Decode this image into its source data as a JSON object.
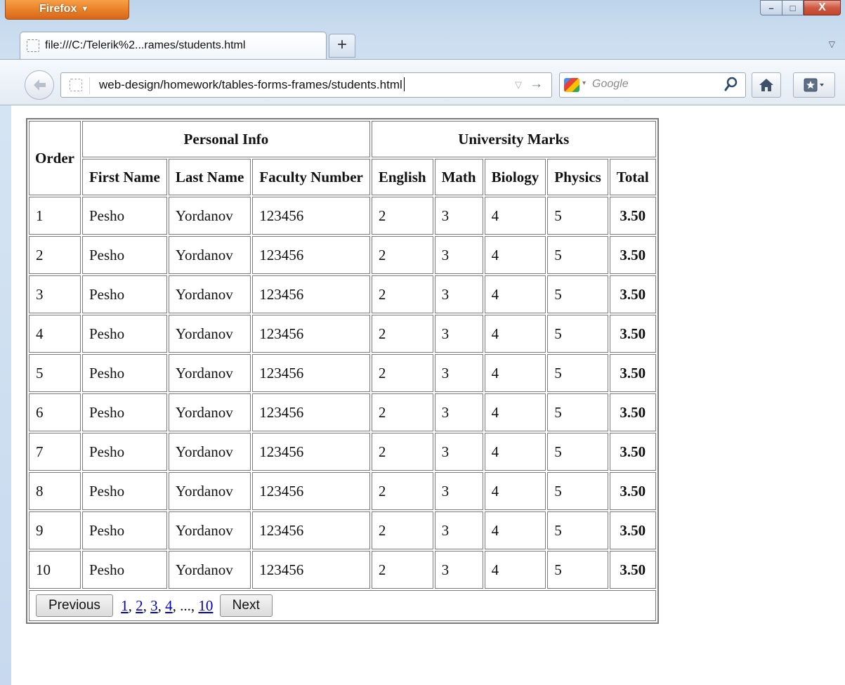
{
  "browser": {
    "menu_button": "Firefox",
    "menu_caret": "▼",
    "tab_title": "file:///C:/Telerik%2...rames/students.html",
    "new_tab": "+",
    "tabs_list": "▽",
    "url": "web-design/homework/tables-forms-frames/students.html",
    "url_dropmark": "▽",
    "go_arrow": "→",
    "search_placeholder": "Google",
    "engine_caret": "▾",
    "window_controls": {
      "minimize": "–",
      "maximize": "□",
      "close": "X"
    },
    "accent_color": "#e9822a"
  },
  "table": {
    "group_headers": {
      "order": "Order",
      "personal": "Personal Info",
      "marks": "University Marks"
    },
    "columns": {
      "first_name": "First Name",
      "last_name": "Last Name",
      "faculty_number": "Faculty Number",
      "english": "English",
      "math": "Math",
      "biology": "Biology",
      "physics": "Physics",
      "total": "Total"
    },
    "rows": [
      {
        "order": "1",
        "first": "Pesho",
        "last": "Yordanov",
        "faculty": "123456",
        "english": "2",
        "math": "3",
        "biology": "4",
        "physics": "5",
        "total": "3.50"
      },
      {
        "order": "2",
        "first": "Pesho",
        "last": "Yordanov",
        "faculty": "123456",
        "english": "2",
        "math": "3",
        "biology": "4",
        "physics": "5",
        "total": "3.50"
      },
      {
        "order": "3",
        "first": "Pesho",
        "last": "Yordanov",
        "faculty": "123456",
        "english": "2",
        "math": "3",
        "biology": "4",
        "physics": "5",
        "total": "3.50"
      },
      {
        "order": "4",
        "first": "Pesho",
        "last": "Yordanov",
        "faculty": "123456",
        "english": "2",
        "math": "3",
        "biology": "4",
        "physics": "5",
        "total": "3.50"
      },
      {
        "order": "5",
        "first": "Pesho",
        "last": "Yordanov",
        "faculty": "123456",
        "english": "2",
        "math": "3",
        "biology": "4",
        "physics": "5",
        "total": "3.50"
      },
      {
        "order": "6",
        "first": "Pesho",
        "last": "Yordanov",
        "faculty": "123456",
        "english": "2",
        "math": "3",
        "biology": "4",
        "physics": "5",
        "total": "3.50"
      },
      {
        "order": "7",
        "first": "Pesho",
        "last": "Yordanov",
        "faculty": "123456",
        "english": "2",
        "math": "3",
        "biology": "4",
        "physics": "5",
        "total": "3.50"
      },
      {
        "order": "8",
        "first": "Pesho",
        "last": "Yordanov",
        "faculty": "123456",
        "english": "2",
        "math": "3",
        "biology": "4",
        "physics": "5",
        "total": "3.50"
      },
      {
        "order": "9",
        "first": "Pesho",
        "last": "Yordanov",
        "faculty": "123456",
        "english": "2",
        "math": "3",
        "biology": "4",
        "physics": "5",
        "total": "3.50"
      },
      {
        "order": "10",
        "first": "Pesho",
        "last": "Yordanov",
        "faculty": "123456",
        "english": "2",
        "math": "3",
        "biology": "4",
        "physics": "5",
        "total": "3.50"
      }
    ]
  },
  "pagination": {
    "previous": "Previous",
    "pages": [
      "1",
      "2",
      "3",
      "4"
    ],
    "ellipsis": "...",
    "last_page": "10",
    "next": "Next"
  }
}
